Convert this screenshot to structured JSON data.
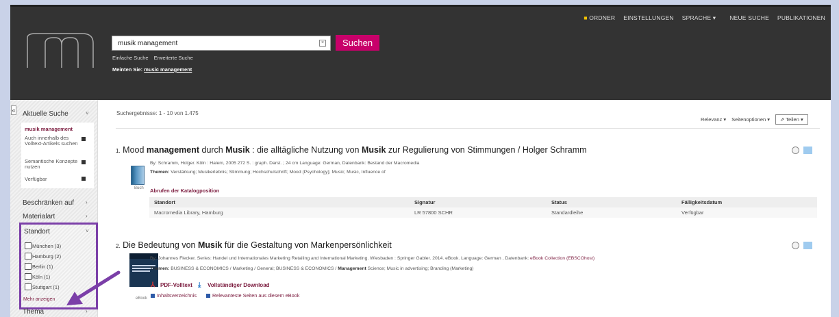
{
  "header": {
    "nav": [
      "ORDNER",
      "EINSTELLUNGEN",
      "SPRACHE",
      "NEUE SUCHE",
      "PUBLIKATIONEN"
    ],
    "search_value": "musik management",
    "search_button": "Suchen",
    "links": [
      "Einfache Suche",
      "Erweiterte Suche"
    ],
    "suggest_prefix": "Meinten Sie:",
    "suggest_term": "music management"
  },
  "sidebar": {
    "aktuelle": "Aktuelle Suche",
    "current_term": "musik management",
    "option1": "Auch innerhalb des Volltext-Artikels suchen",
    "option2": "Semantische Konzepte nutzen",
    "option3": "Verfügbar",
    "beschraenken": "Beschränken auf",
    "materialart": "Materialart",
    "standort": "Standort",
    "locations": [
      "München (3)",
      "Hamburg (2)",
      "Berlin (1)",
      "Köln (1)",
      "Stuttgart (1)"
    ],
    "more": "Mehr anzeigen",
    "thema": "Thema"
  },
  "main": {
    "results_count": "Suchergebnisse: 1 - 10 von 1.475",
    "sort": "Relevanz",
    "page_options": "Seitenoptionen",
    "share": "Teilen",
    "r1": {
      "num": "1.",
      "t1": "Mood ",
      "t2": "management",
      "t3": " durch ",
      "t4": "Musik",
      "t5": " : die alltägliche Nutzung von ",
      "t6": "Musik",
      "t7": " zur Regulierung von Stimmungen / Holger Schramm",
      "by": "By: Schramm, Holger. Köln : Halem, 2005 272 S. : graph. Darst. ; 24 cm Language: German, Datenbank: Bestand der Macromedia",
      "topics_label": "Themen:",
      "topics": " Verstärkung; Musikerlebnis; Stimmung; Hochschulschrift; Mood (Psychology); Music; Music, Influence of",
      "type": "Buch",
      "holdings_label": "Abrufen der Katalogposition",
      "cols": [
        "Standort",
        "Signatur",
        "Status",
        "Fälligkeitsdatum"
      ],
      "row": [
        "Macromedia Library, Hamburg",
        "LR 57800 SCHR",
        "Standardleihe",
        "Verfügbar"
      ]
    },
    "r2": {
      "num": "2.",
      "t1": "Die Bedeutung von ",
      "t2": "Musik",
      "t3": " für die Gestaltung von Markenpersönlichkeit",
      "by": "By: Johannes Flecker. Series: Handel und Internationales Marketing Retailing and International Marketing. Wiesbaden : Springer Gabler. 2014. eBook. Language: German , Datenbank: ",
      "by_link": "eBook Collection (EBSCOhost)",
      "topics_label": "Themen:",
      "topics_a": " BUSINESS & ECONOMICS / Marketing / General; BUSINESS & ECONOMICS / ",
      "topics_b": "Management",
      "topics_c": " Science; Music in advertising; Branding (Marketing)",
      "type": "eBook",
      "pdf": "PDF-Volltext",
      "download": "Vollständiger Download",
      "toc": "Inhaltsverzeichnis",
      "relevant": "Relevanteste Seiten aus diesem eBook"
    }
  },
  "colors": {
    "accent": "#c8006a",
    "header": "#333333",
    "highlight_box": "#7b3fa8"
  }
}
